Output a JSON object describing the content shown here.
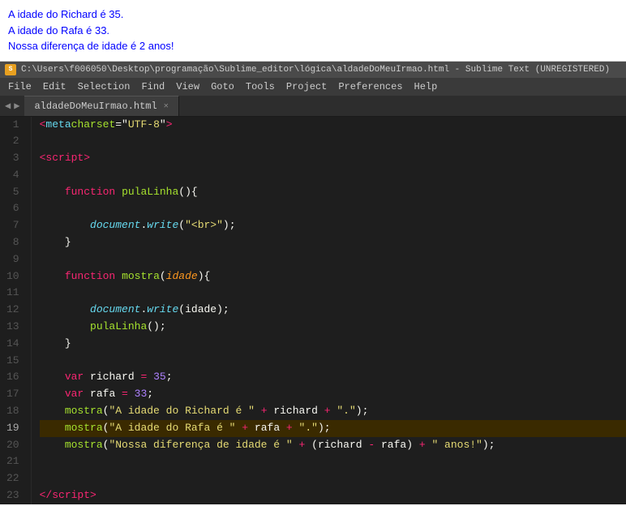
{
  "browser": {
    "lines": [
      "A idade do Richard é 35.",
      "A idade do Rafa é 33.",
      "Nossa diferença de idade é 2 anos!"
    ]
  },
  "titlebar": {
    "text": "C:\\Users\\f006050\\Desktop\\programação\\Sublime_editor\\lógica\\aldadeDoMeuIrmao.html - Sublime Text (UNREGISTERED)"
  },
  "menubar": {
    "items": [
      "File",
      "Edit",
      "Selection",
      "Find",
      "View",
      "Goto",
      "Tools",
      "Project",
      "Preferences",
      "Help"
    ]
  },
  "tab": {
    "name": "aldadeDoMeuIrmao.html"
  },
  "lines": [
    {
      "num": 1,
      "highlighted": false
    },
    {
      "num": 2,
      "highlighted": false
    },
    {
      "num": 3,
      "highlighted": false
    },
    {
      "num": 4,
      "highlighted": false
    },
    {
      "num": 5,
      "highlighted": false
    },
    {
      "num": 6,
      "highlighted": false
    },
    {
      "num": 7,
      "highlighted": false
    },
    {
      "num": 8,
      "highlighted": false
    },
    {
      "num": 9,
      "highlighted": false
    },
    {
      "num": 10,
      "highlighted": false
    },
    {
      "num": 11,
      "highlighted": false
    },
    {
      "num": 12,
      "highlighted": false
    },
    {
      "num": 13,
      "highlighted": false
    },
    {
      "num": 14,
      "highlighted": false
    },
    {
      "num": 15,
      "highlighted": false
    },
    {
      "num": 16,
      "highlighted": false
    },
    {
      "num": 17,
      "highlighted": false
    },
    {
      "num": 18,
      "highlighted": false
    },
    {
      "num": 19,
      "highlighted": true
    },
    {
      "num": 20,
      "highlighted": false
    },
    {
      "num": 21,
      "highlighted": false
    },
    {
      "num": 22,
      "highlighted": false
    },
    {
      "num": 23,
      "highlighted": false
    }
  ]
}
